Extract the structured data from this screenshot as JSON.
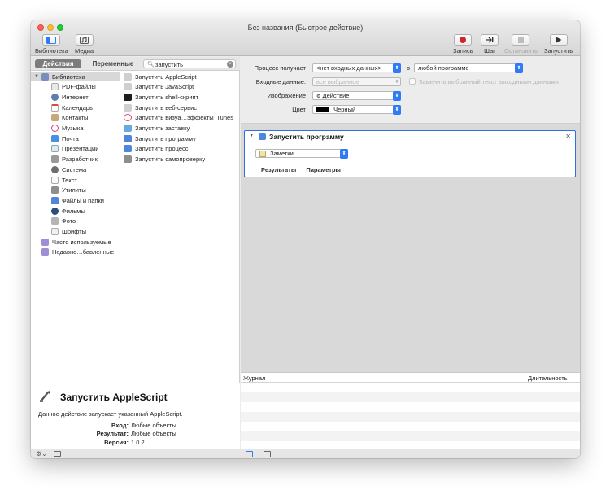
{
  "window": {
    "title": "Без названия (Быстрое действие)"
  },
  "toolbar": {
    "library": "Библиотека",
    "media": "Медиа",
    "record": "Запись",
    "step": "Шаг",
    "stop": "Остановить",
    "run": "Запустить"
  },
  "tabs": {
    "actions": "Действия",
    "variables": "Переменные"
  },
  "search": {
    "query": "запустить"
  },
  "categories": [
    "Библиотека",
    "PDF-файлы",
    "Интернет",
    "Календарь",
    "Контакты",
    "Музыка",
    "Почта",
    "Презентации",
    "Разработчик",
    "Система",
    "Текст",
    "Утилиты",
    "Файлы и папки",
    "Фильмы",
    "Фото",
    "Шрифты",
    "Часто используемые",
    "Недавно…бавленные"
  ],
  "actions": [
    "Запустить AppleScript",
    "Запустить JavaScript",
    "Запустить shell-скрипт",
    "Запустить веб-сервис",
    "Запустить визуа…эффекты iTunes",
    "Запустить заставку",
    "Запустить программу",
    "Запустить процесс",
    "Запустить самопроверку"
  ],
  "description": {
    "title": "Запустить AppleScript",
    "text": "Данное действие запускает указанный AppleScript.",
    "input_label": "Вход:",
    "input_value": "Любые объекты",
    "result_label": "Результат:",
    "result_value": "Любые объекты",
    "version_label": "Версия:",
    "version_value": "1.0.2"
  },
  "workflow_settings": {
    "receives_label": "Процесс получает",
    "receives_value": "<нет входных данных>",
    "in_label": "в",
    "in_value": "любой программе",
    "input_label": "Входные данные:",
    "input_value": "все выбранное",
    "replace_label": "Заменить выбранный текст выходными данными",
    "image_label": "Изображение",
    "image_value": "Действие",
    "color_label": "Цвет",
    "color_value": "Черный"
  },
  "action_box": {
    "title": "Запустить программу",
    "app": "Заметки",
    "tab_results": "Результаты",
    "tab_options": "Параметры"
  },
  "log": {
    "col_log": "Журнал",
    "col_duration": "Длительность"
  },
  "colors": {
    "accent": "#2f7bf5",
    "record": "#d0262b",
    "selected_row": "#d8d8d8"
  }
}
